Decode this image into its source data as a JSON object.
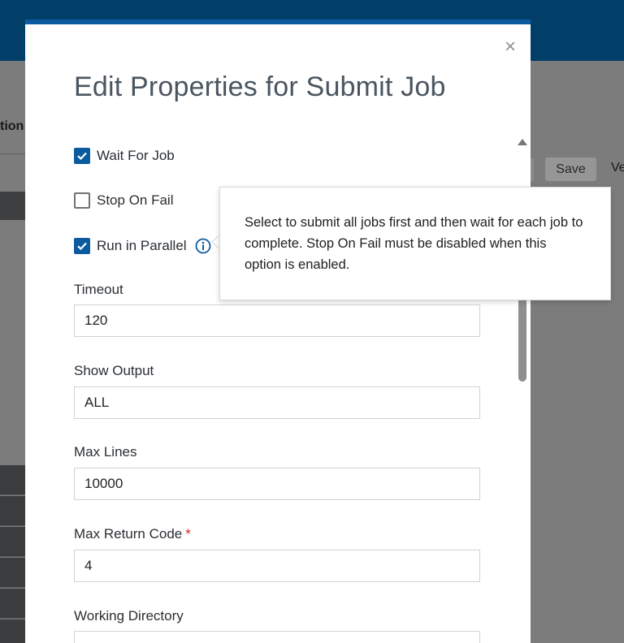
{
  "background": {
    "column_header_fragment": "tion",
    "save_button_label": "Save",
    "next_button_fragment": "Ve"
  },
  "modal": {
    "title": "Edit Properties for Submit Job",
    "close_symbol": "×",
    "checkboxes": [
      {
        "label": "Wait For Job",
        "checked": true
      },
      {
        "label": "Stop On Fail",
        "checked": false
      },
      {
        "label": "Run in Parallel",
        "checked": true
      }
    ],
    "fields": {
      "timeout": {
        "label": "Timeout",
        "value": "120"
      },
      "show_output": {
        "label": "Show Output",
        "value": "ALL"
      },
      "max_lines": {
        "label": "Max Lines",
        "value": "10000"
      },
      "max_return_code": {
        "label": "Max Return Code",
        "required_mark": "*",
        "value": "4"
      },
      "working_directory": {
        "label": "Working Directory",
        "value": ""
      }
    }
  },
  "tooltip": {
    "text": "Select to submit all jobs first and then wait for each job to complete. Stop On Fail must be disabled when this option is enabled."
  },
  "colors": {
    "accent": "#0c5b9e",
    "header_bar": "#013e68",
    "required": "#d9201c"
  },
  "icons": {
    "close": "close-icon",
    "info": "info-icon",
    "check": "checkmark-icon",
    "scroll_up": "scroll-up-arrow-icon"
  }
}
